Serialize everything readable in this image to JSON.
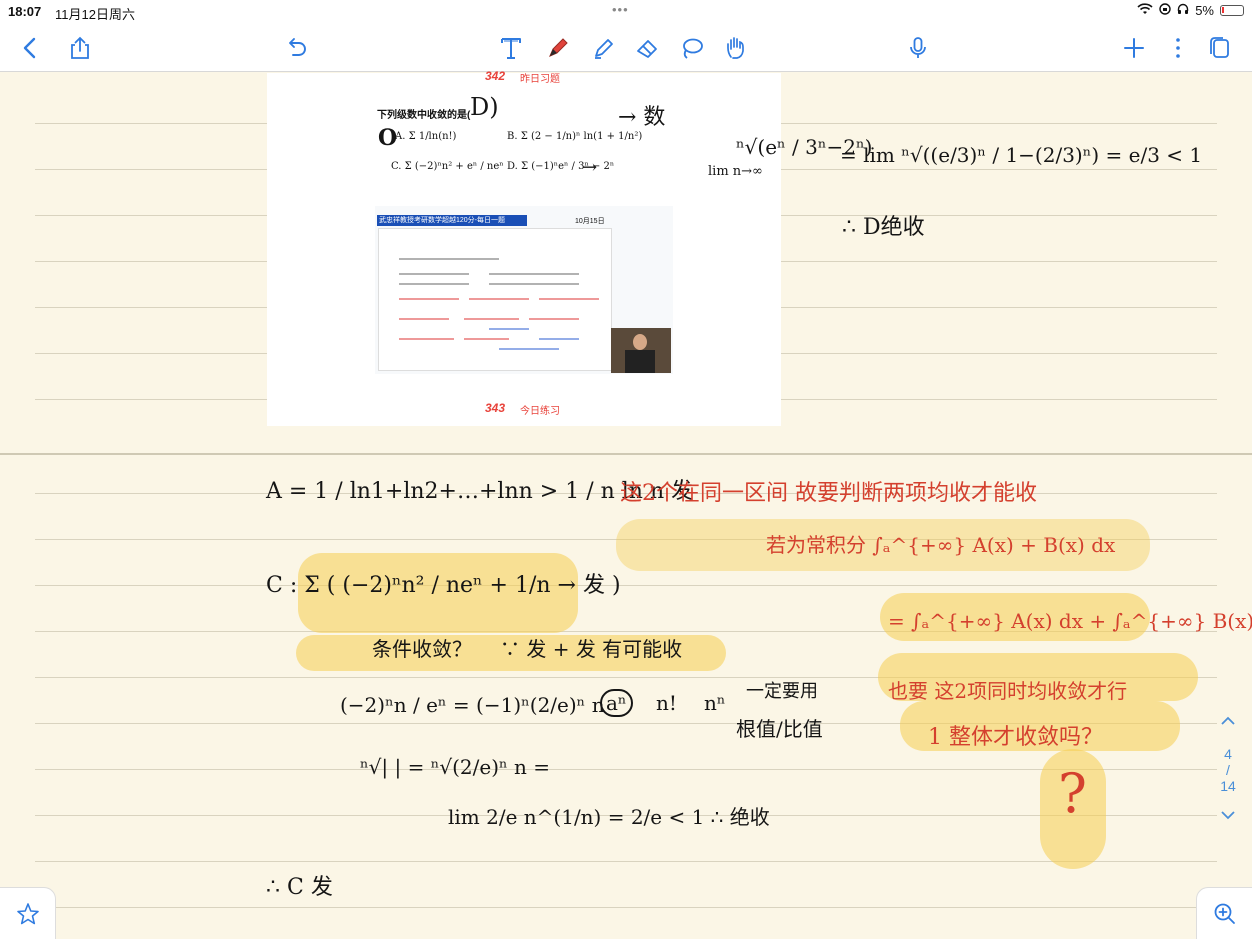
{
  "status_bar": {
    "time": "18:07",
    "date": "11月12日周六",
    "battery_percent": "5%"
  },
  "toolbar": {
    "tools": [
      "back",
      "share",
      "undo",
      "text",
      "pen",
      "highlighter",
      "eraser",
      "lasso",
      "hand",
      "microphone",
      "add",
      "more",
      "pages"
    ]
  },
  "pasted": {
    "num_top": "342",
    "label_top": "昨日习题",
    "question": "下列级数中收敛的是(",
    "option_a": "A. Σ 1/ln(n!)",
    "option_b": "B. Σ (2 − 1/n)ⁿ ln(1 + 1/n²)",
    "option_c": "C. Σ (−2)ⁿn² + eⁿ / neⁿ",
    "option_d": "D. Σ (−1)ⁿeⁿ / 3ⁿ − 2ⁿ",
    "video_banner": "武忠祥教授考研数学超越120分-每日一题",
    "video_date": "10月15日",
    "num_bottom": "343",
    "label_bottom": "今日练习"
  },
  "notes": {
    "mark_d": "D)",
    "mark_o": "O",
    "arrow_shu": "→ 数",
    "arrow_d": "→",
    "d_root": "ⁿ√(eⁿ / 3ⁿ−2ⁿ)",
    "d_eq": "= lim ⁿ√((e/3)ⁿ / 1−(2/3)ⁿ) = e/3 < 1",
    "d_lim": "lim n→∞",
    "d_conclusion": "∴ D绝收",
    "a_line": "A = 1 / ln1+ln2+…+lnn  >  1 / n ln n  发",
    "c_line": "C : Σ ( (−2)ⁿn² / neⁿ + 1/n → 发 )",
    "c_cond": "条件收敛？",
    "c_reason": "∵ 发 + 发  有可能收",
    "c_frac": "(−2)ⁿn / eⁿ = (−1)ⁿ(2/e)ⁿ n",
    "c_circle": "aⁿ",
    "c_nfact": "n!",
    "c_nn": "nⁿ",
    "c_note1": "一定要用",
    "c_note2": "根值/比值",
    "c_root": "ⁿ√|  | = ⁿ√(2/e)ⁿ n =",
    "c_lim": "lim 2/e n^(1/n) = 2/e < 1 ∴ 绝收",
    "c_conclusion": "∴ C 发",
    "r1": "这2个在同一区间 故要判断两项均收才能收",
    "r2": "若为常积分 ∫ₐ^{+∞} A(x) + B(x) dx",
    "r3": "= ∫ₐ^{+∞} A(x) dx + ∫ₐ^{+∞} B(x) dx",
    "r4": "也要 这2项同时均收敛才行",
    "r5": "1 整体才收敛吗？",
    "r6": "?"
  },
  "pager": {
    "current": "4",
    "separator": "/",
    "total": "14"
  }
}
